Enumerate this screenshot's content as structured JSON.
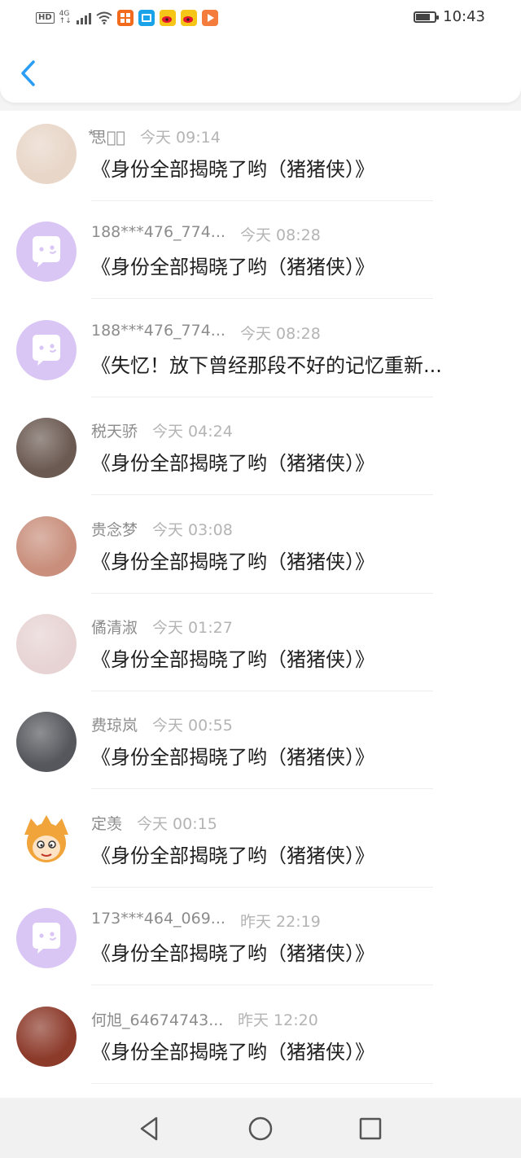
{
  "status_bar": {
    "hd": "HD",
    "network_top": "4G",
    "network_bottom": "↑↓",
    "time": "10:43",
    "battery_level": 0.85,
    "icons": [
      "hd-icon",
      "signal-icon",
      "wifi-icon",
      "app-icon-orange",
      "app-icon-blue",
      "weibo-icon",
      "weibo-icon",
      "app-icon-orange-play"
    ]
  },
  "header": {
    "back_icon": "chevron-left-icon",
    "accent_color": "#2a9df4"
  },
  "messages": [
    {
      "name": "⃰思念⃰",
      "time": "今天 09:14",
      "text": "《身份全部揭晓了哟（猪猪侠）》",
      "avatar": "photo-avatar",
      "avatar_color": "#e8d6c8"
    },
    {
      "name": "188***476_774...",
      "time": "今天 08:28",
      "text": "《身份全部揭晓了哟（猪猪侠）》",
      "avatar": "default-chat-avatar",
      "avatar_color": "#d9c6f5"
    },
    {
      "name": "188***476_774...",
      "time": "今天 08:28",
      "text": "《失忆！放下曾经那段不好的记忆重新...",
      "avatar": "default-chat-avatar",
      "avatar_color": "#d9c6f5"
    },
    {
      "name": "税天骄",
      "time": "今天 04:24",
      "text": "《身份全部揭晓了哟（猪猪侠）》",
      "avatar": "photo-avatar",
      "avatar_color": "#6b5a52"
    },
    {
      "name": "贵念梦",
      "time": "今天 03:08",
      "text": "《身份全部揭晓了哟（猪猪侠）》",
      "avatar": "photo-avatar",
      "avatar_color": "#c98f7c"
    },
    {
      "name": "僪清淑",
      "time": "今天 01:27",
      "text": "《身份全部揭晓了哟（猪猪侠）》",
      "avatar": "photo-avatar",
      "avatar_color": "#e7d3d3"
    },
    {
      "name": "费琼岚",
      "time": "今天 00:55",
      "text": "《身份全部揭晓了哟（猪猪侠）》",
      "avatar": "photo-avatar",
      "avatar_color": "#55575c"
    },
    {
      "name": "定羡",
      "time": "今天 00:15",
      "text": "《身份全部揭晓了哟（猪猪侠）》",
      "avatar": "cartoon-avatar",
      "avatar_color": "#f0a43a"
    },
    {
      "name": "173***464_069...",
      "time": "昨天 22:19",
      "text": "《身份全部揭晓了哟（猪猪侠）》",
      "avatar": "default-chat-avatar",
      "avatar_color": "#d9c6f5"
    },
    {
      "name": "何旭_64674743...",
      "time": "昨天 12:20",
      "text": "《身份全部揭晓了哟（猪猪侠）》",
      "avatar": "photo-avatar",
      "avatar_color": "#8c3a2a"
    }
  ],
  "nav_bar": {
    "buttons": [
      "back-triangle-icon",
      "home-circle-icon",
      "recents-square-icon"
    ]
  }
}
